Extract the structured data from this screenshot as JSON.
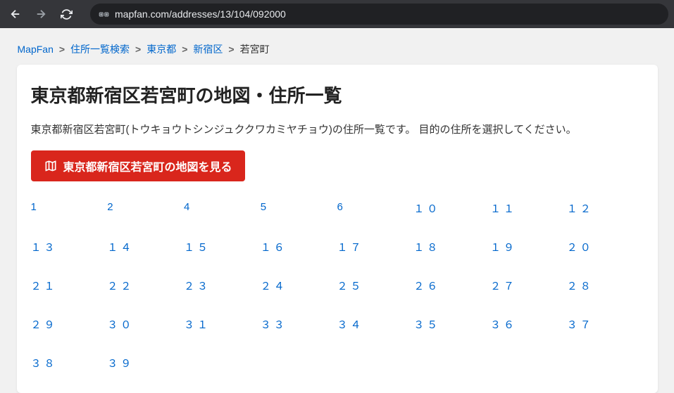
{
  "browser": {
    "url": "mapfan.com/addresses/13/104/092000"
  },
  "breadcrumb": {
    "items": [
      {
        "label": "MapFan",
        "link": true
      },
      {
        "label": "住所一覧検索",
        "link": true
      },
      {
        "label": "東京都",
        "link": true
      },
      {
        "label": "新宿区",
        "link": true
      },
      {
        "label": "若宮町",
        "link": false
      }
    ]
  },
  "page": {
    "title": "東京都新宿区若宮町の地図・住所一覧",
    "description": "東京都新宿区若宮町(トウキョウトシンジュククワカミヤチョウ)の住所一覧です。 目的の住所を選択してください。",
    "map_button_label": "東京都新宿区若宮町の地図を見る"
  },
  "addresses": [
    "1",
    "2",
    "4",
    "5",
    "6",
    "１０",
    "１１",
    "１２",
    "１３",
    "１４",
    "１５",
    "１６",
    "１７",
    "１８",
    "１９",
    "２０",
    "２１",
    "２２",
    "２３",
    "２４",
    "２５",
    "２６",
    "２７",
    "２８",
    "２９",
    "３０",
    "３１",
    "３３",
    "３４",
    "３５",
    "３６",
    "３７",
    "３８",
    "３９"
  ]
}
